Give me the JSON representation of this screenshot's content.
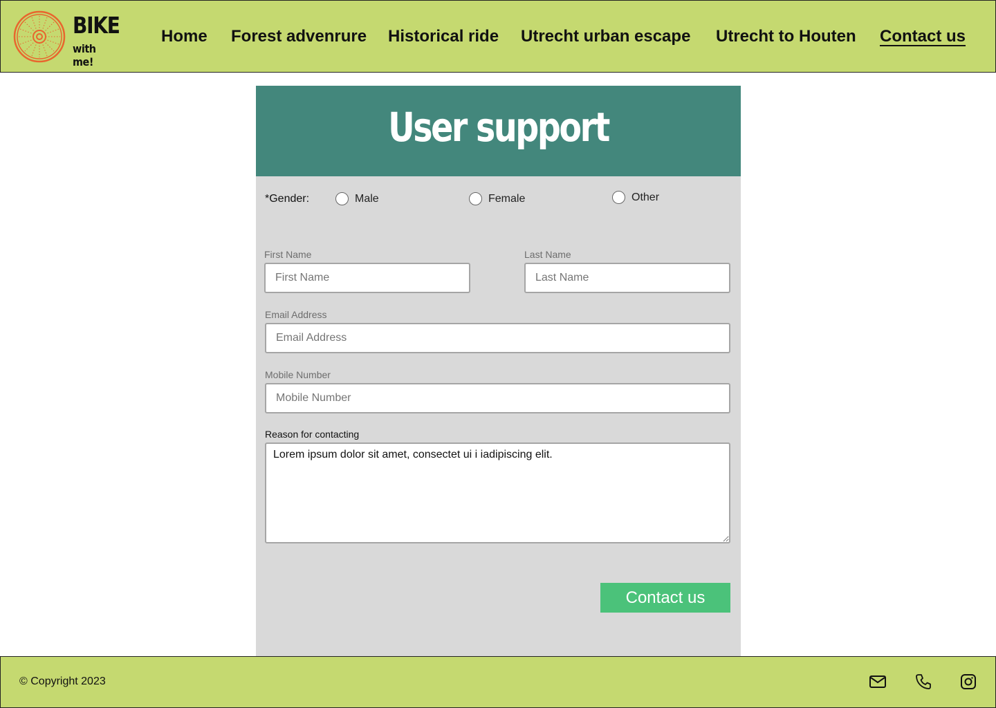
{
  "brand": {
    "name": "BIKE",
    "tagline": "with me!",
    "accent": "#e8662e"
  },
  "nav": {
    "items": [
      {
        "label": "Home"
      },
      {
        "label": "Forest advenrure"
      },
      {
        "label": "Historical ride"
      },
      {
        "label": "Utrecht urban escape"
      },
      {
        "label": "Utrecht to Houten"
      },
      {
        "label": "Contact us",
        "active": true
      }
    ]
  },
  "form": {
    "title": "User support",
    "gender": {
      "label": "*Gender:",
      "options": [
        "Male",
        "Female",
        "Other"
      ],
      "selected": null
    },
    "first_name": {
      "label": "First Name",
      "placeholder": "First Name"
    },
    "last_name": {
      "label": "Last Name",
      "placeholder": "Last Name"
    },
    "email": {
      "label": "Email Address",
      "placeholder": "Email Address"
    },
    "mobile": {
      "label": "Mobile Number",
      "placeholder": "Mobile Number"
    },
    "reason": {
      "label": "Reason for contacting",
      "value": "Lorem ipsum dolor sit amet, consectet ui i iadipiscing elit."
    },
    "submit_label": "Contact us"
  },
  "footer": {
    "copyright": "© Copyright 2023",
    "icons": [
      "mail-icon",
      "phone-icon",
      "instagram-icon"
    ]
  },
  "colors": {
    "header_bg": "#c5d970",
    "panel_head_bg": "#43877c",
    "panel_bg": "#d9d9d9",
    "submit_bg": "#4bc27a"
  }
}
